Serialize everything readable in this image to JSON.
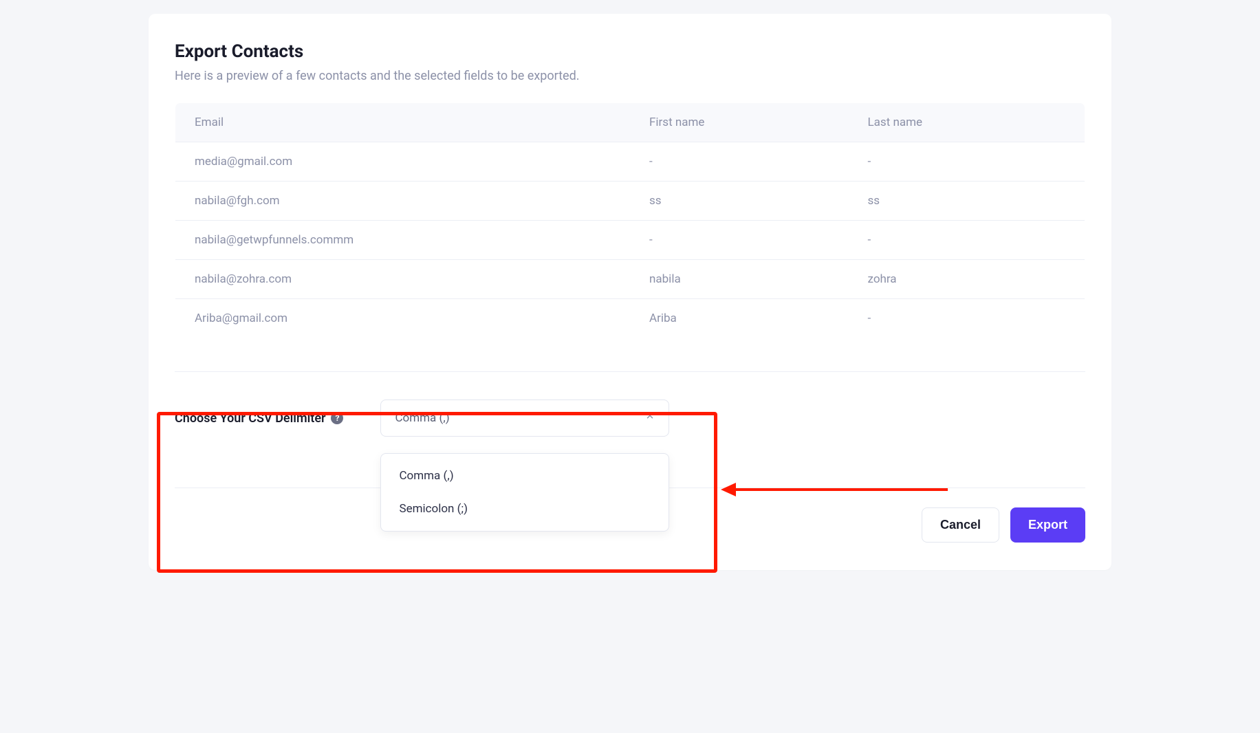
{
  "header": {
    "title": "Export Contacts",
    "subtitle": "Here is a preview of a few contacts and the selected fields to be exported."
  },
  "table": {
    "headers": [
      "Email",
      "First name",
      "Last name"
    ],
    "rows": [
      {
        "email": "media@gmail.com",
        "first_name": "-",
        "last_name": "-"
      },
      {
        "email": "nabila@fgh.com",
        "first_name": "ss",
        "last_name": "ss"
      },
      {
        "email": "nabila@getwpfunnels.commm",
        "first_name": "-",
        "last_name": "-"
      },
      {
        "email": "nabila@zohra.com",
        "first_name": "nabila",
        "last_name": "zohra"
      },
      {
        "email": "Ariba@gmail.com",
        "first_name": "Ariba",
        "last_name": "-"
      }
    ]
  },
  "delimiter": {
    "label": "Choose Your CSV Delimiter",
    "selected": "Comma (,)",
    "options": [
      "Comma (,)",
      "Semicolon (;)"
    ]
  },
  "footer": {
    "cancel_label": "Cancel",
    "export_label": "Export"
  },
  "icons": {
    "help": "?"
  }
}
